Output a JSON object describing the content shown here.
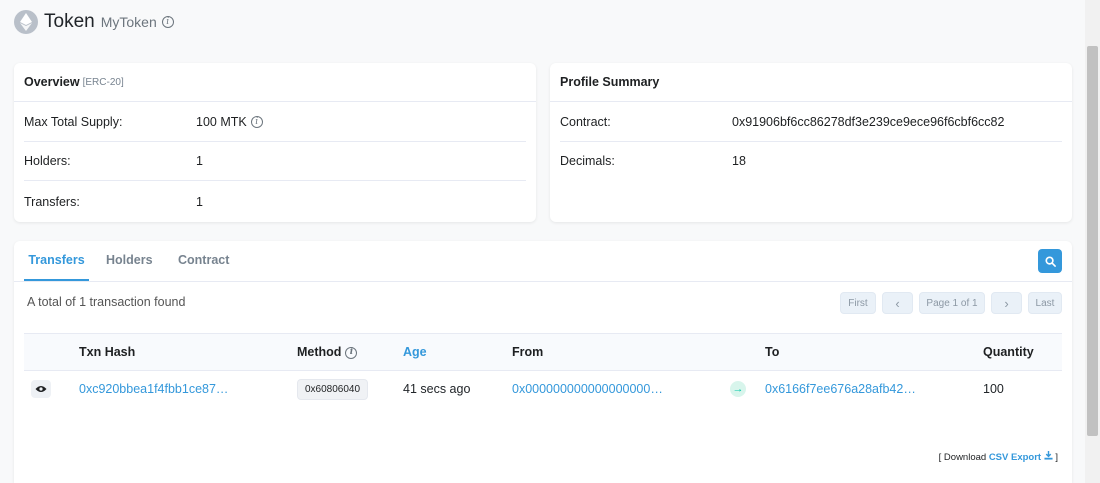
{
  "header": {
    "title": "Token",
    "subtitle": "MyToken",
    "logo_icon": "ethereum-icon"
  },
  "overview": {
    "title": "Overview",
    "tag": "[ERC-20]",
    "rows": [
      {
        "label": "Max Total Supply:",
        "value": "100 MTK"
      },
      {
        "label": "Holders:",
        "value": "1"
      },
      {
        "label": "Transfers:",
        "value": "1"
      }
    ]
  },
  "profile": {
    "title": "Profile Summary",
    "rows": [
      {
        "label": "Contract:",
        "value": "0x91906bf6cc86278df3e239ce9ece96f6cbf6cc82"
      },
      {
        "label": "Decimals:",
        "value": "18"
      }
    ]
  },
  "tabs": [
    {
      "label": "Transfers",
      "active": true
    },
    {
      "label": "Holders",
      "active": false
    },
    {
      "label": "Contract",
      "active": false
    }
  ],
  "transfers": {
    "total_text": "A total of 1 transaction found",
    "pager": {
      "first": "First",
      "prev": "‹",
      "page": "Page 1 of 1",
      "next": "›",
      "last": "Last"
    },
    "columns": {
      "txn_hash": "Txn Hash",
      "method": "Method",
      "age": "Age",
      "from": "From",
      "to": "To",
      "quantity": "Quantity"
    },
    "rows": [
      {
        "txn_hash": "0xc920bbea1f4fbb1ce87…",
        "method": "0x60806040",
        "age": "41 secs ago",
        "from": "0x000000000000000000…",
        "to": "0x6166f7ee676a28afb42…",
        "quantity": "100"
      }
    ],
    "download": {
      "prefix": "[ Download",
      "link": "CSV Export",
      "suffix": "]"
    }
  },
  "colors": {
    "accent": "#3498db",
    "success": "#00c9a7",
    "text": "#1e2022",
    "muted": "#77838f"
  }
}
